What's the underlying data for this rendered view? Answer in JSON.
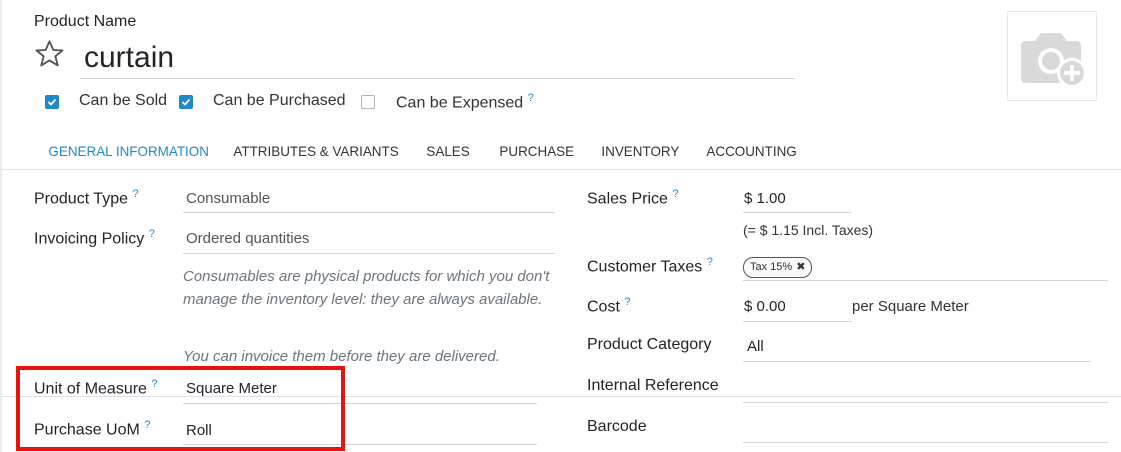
{
  "product": {
    "name_label": "Product Name",
    "name_value": "curtain"
  },
  "options": {
    "can_be_sold": {
      "label": "Can be Sold",
      "checked": true
    },
    "can_be_purchased": {
      "label": "Can be Purchased",
      "checked": true
    },
    "can_be_expensed": {
      "label": "Can be Expensed",
      "checked": false
    }
  },
  "help_mark": "?",
  "tabs": [
    "GENERAL INFORMATION",
    "ATTRIBUTES & VARIANTS",
    "SALES",
    "PURCHASE",
    "INVENTORY",
    "ACCOUNTING"
  ],
  "left_fields": {
    "product_type": {
      "label": "Product Type",
      "value": "Consumable"
    },
    "invoicing_policy": {
      "label": "Invoicing Policy",
      "value": "Ordered quantities"
    },
    "consumable_help": "Consumables are physical products for which you don't manage the inventory level: they are always available.",
    "invoice_help": "You can invoice them before they are delivered.",
    "unit_of_measure": {
      "label": "Unit of Measure",
      "value": "Square Meter"
    },
    "purchase_uom": {
      "label": "Purchase UoM",
      "value": "Roll"
    }
  },
  "right_fields": {
    "sales_price": {
      "label": "Sales Price",
      "value": "$ 1.00",
      "incl_taxes": "(= $ 1.15 Incl. Taxes)"
    },
    "customer_taxes": {
      "label": "Customer Taxes",
      "tag": "Tax 15%",
      "tag_remove": "✖"
    },
    "cost": {
      "label": "Cost",
      "value": "$ 0.00",
      "unit": "per Square Meter"
    },
    "product_category": {
      "label": "Product Category",
      "value": "All"
    },
    "internal_reference": {
      "label": "Internal Reference",
      "value": ""
    },
    "barcode": {
      "label": "Barcode",
      "value": ""
    }
  },
  "colors": {
    "accent": "#1f8acb",
    "highlight": "#e8130e"
  }
}
